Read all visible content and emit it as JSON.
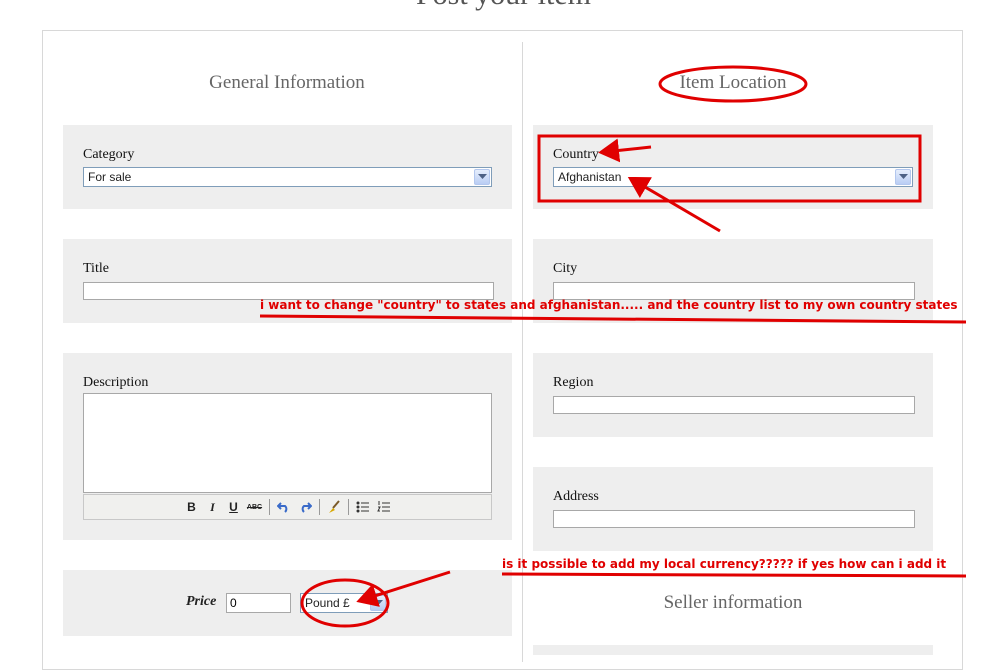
{
  "page": {
    "title": "Post your item"
  },
  "general": {
    "heading": "General Information",
    "category": {
      "label": "Category",
      "value": "For sale"
    },
    "title_field": {
      "label": "Title",
      "value": ""
    },
    "description": {
      "label": "Description",
      "value": ""
    },
    "toolbar": {
      "bold": "B",
      "italic": "I",
      "underline": "U",
      "strike": "ABC",
      "undo_icon": "undo-icon",
      "redo_icon": "redo-icon",
      "clean_icon": "brush-icon",
      "bullet_icon": "bullet-list-icon",
      "number_icon": "numbered-list-icon"
    },
    "price": {
      "label": "Price",
      "value": "0",
      "currency": "Pound £"
    }
  },
  "location": {
    "heading": "Item Location",
    "country": {
      "label": "Country",
      "value": "Afghanistan"
    },
    "city": {
      "label": "City",
      "value": ""
    },
    "region": {
      "label": "Region",
      "value": ""
    },
    "address": {
      "label": "Address",
      "value": ""
    }
  },
  "seller": {
    "heading": "Seller information"
  },
  "annotations": {
    "note1": "i want to change \"country\" to states and afghanistan..... and the country list to my own country states",
    "note2": "is it possible to add my local currency????? if yes how can i add it",
    "color": "#e00000"
  }
}
